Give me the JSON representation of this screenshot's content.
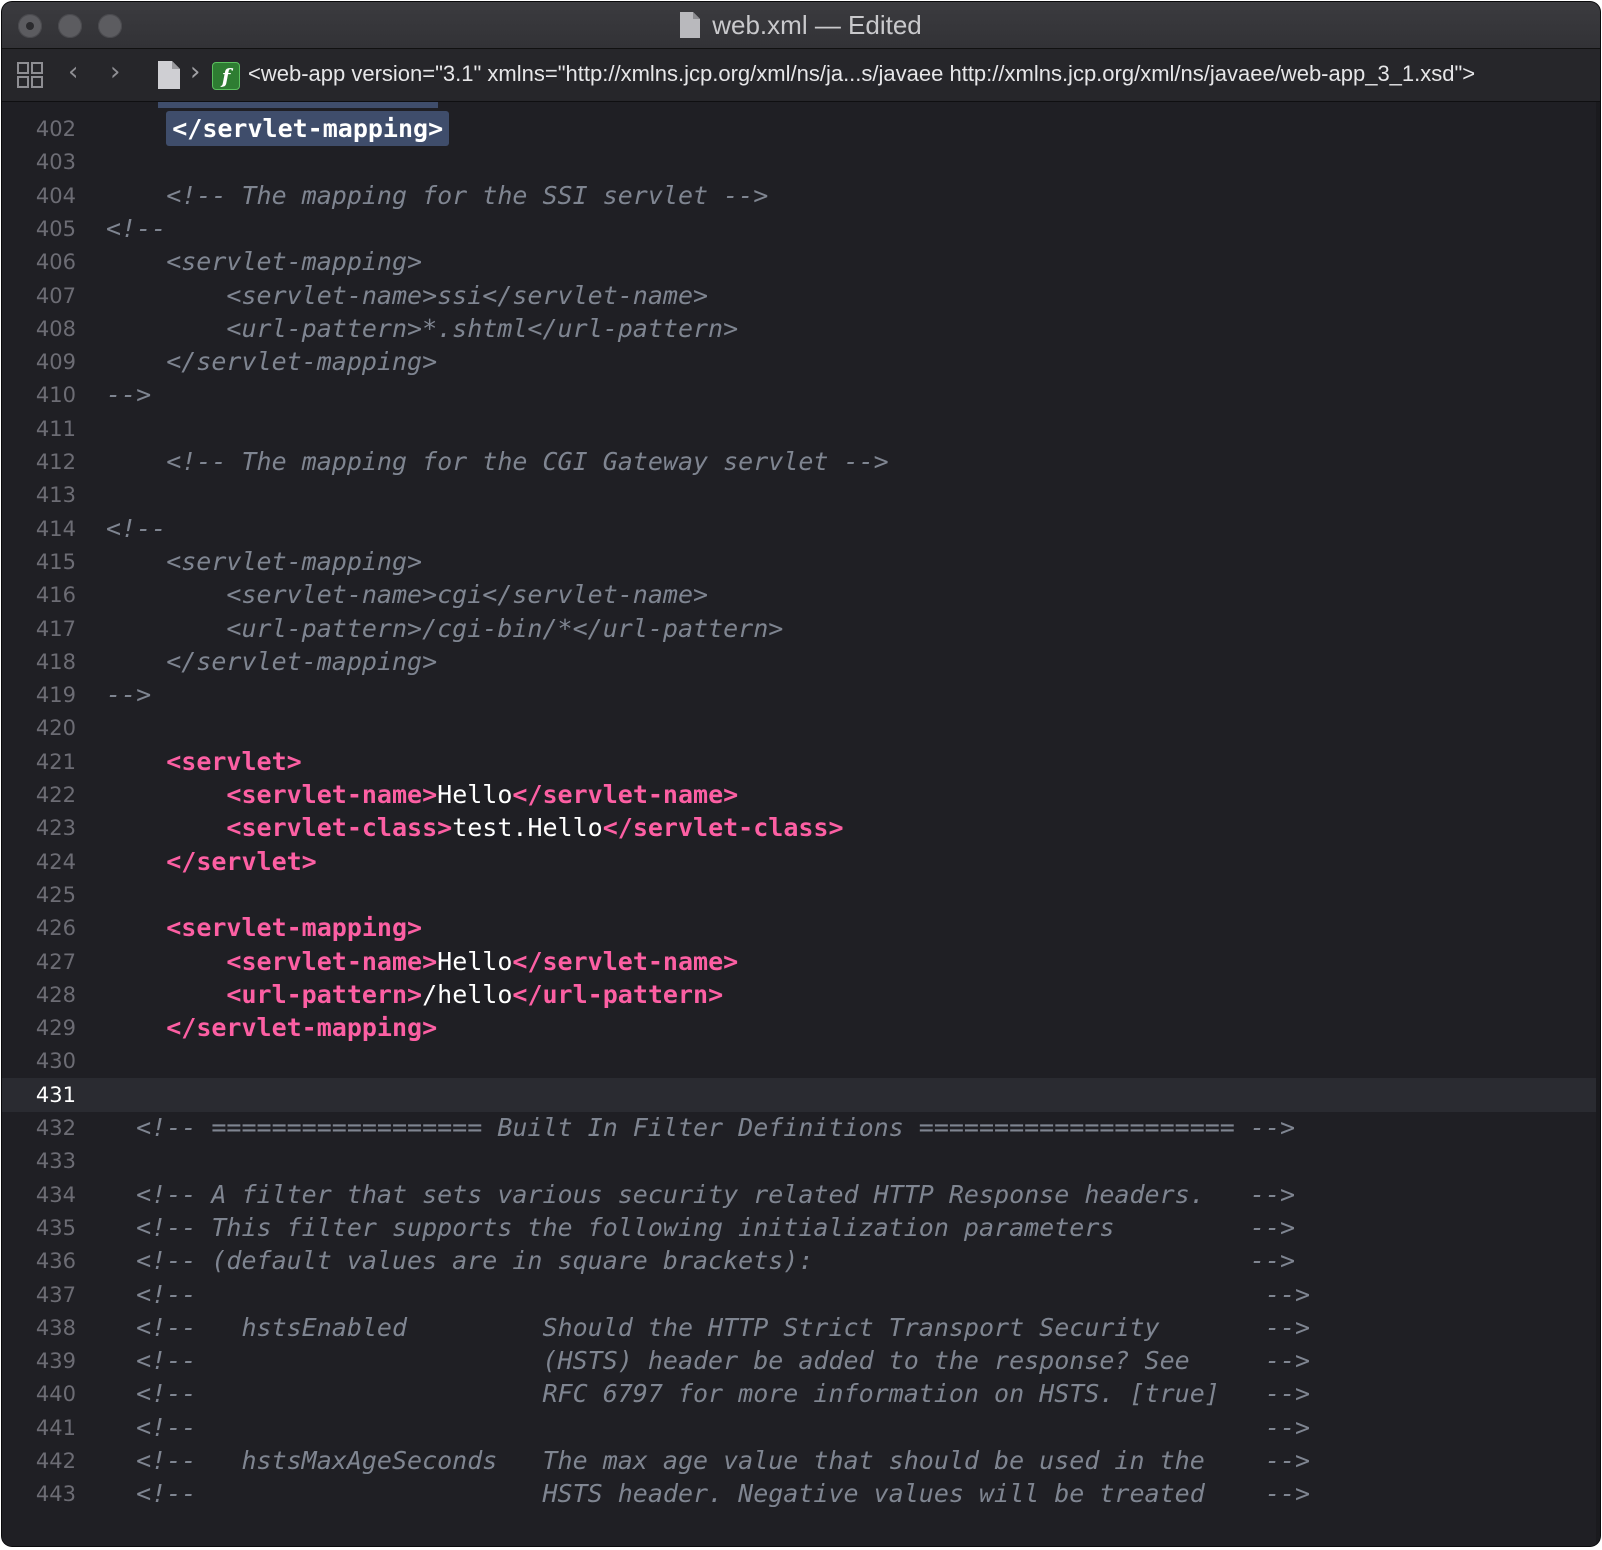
{
  "window": {
    "title": "web.xml — Edited"
  },
  "jumpbar": {
    "path": "<web-app version=\"3.1\" xmlns=\"http://xmlns.jcp.org/xml/ns/ja...s/javaee http://xmlns.jcp.org/xml/ns/javaee/web-app_3_1.xsd\">",
    "function_badge": "f"
  },
  "editor": {
    "current_line": "431",
    "lines": [
      {
        "n": "402",
        "tokens": [
          {
            "t": "    ",
            "c": ""
          },
          {
            "t": "</servlet-mapping>",
            "c": "sel"
          }
        ]
      },
      {
        "n": "403",
        "tokens": []
      },
      {
        "n": "404",
        "tokens": [
          {
            "t": "    <!-- The mapping for the SSI servlet -->",
            "c": "cm"
          }
        ]
      },
      {
        "n": "405",
        "tokens": [
          {
            "t": "<!--",
            "c": "cm"
          }
        ]
      },
      {
        "n": "406",
        "tokens": [
          {
            "t": "    <servlet-mapping>",
            "c": "cm"
          }
        ]
      },
      {
        "n": "407",
        "tokens": [
          {
            "t": "        <servlet-name>ssi</servlet-name>",
            "c": "cm"
          }
        ]
      },
      {
        "n": "408",
        "tokens": [
          {
            "t": "        <url-pattern>*.shtml</url-pattern>",
            "c": "cm"
          }
        ]
      },
      {
        "n": "409",
        "tokens": [
          {
            "t": "    </servlet-mapping>",
            "c": "cm"
          }
        ]
      },
      {
        "n": "410",
        "tokens": [
          {
            "t": "-->",
            "c": "cm"
          }
        ]
      },
      {
        "n": "411",
        "tokens": []
      },
      {
        "n": "412",
        "tokens": [
          {
            "t": "    <!-- The mapping for the CGI Gateway servlet -->",
            "c": "cm"
          }
        ]
      },
      {
        "n": "413",
        "tokens": []
      },
      {
        "n": "414",
        "tokens": [
          {
            "t": "<!--",
            "c": "cm"
          }
        ]
      },
      {
        "n": "415",
        "tokens": [
          {
            "t": "    <servlet-mapping>",
            "c": "cm"
          }
        ]
      },
      {
        "n": "416",
        "tokens": [
          {
            "t": "        <servlet-name>cgi</servlet-name>",
            "c": "cm"
          }
        ]
      },
      {
        "n": "417",
        "tokens": [
          {
            "t": "        <url-pattern>/cgi-bin/*</url-pattern>",
            "c": "cm"
          }
        ]
      },
      {
        "n": "418",
        "tokens": [
          {
            "t": "    </servlet-mapping>",
            "c": "cm"
          }
        ]
      },
      {
        "n": "419",
        "tokens": [
          {
            "t": "-->",
            "c": "cm"
          }
        ]
      },
      {
        "n": "420",
        "tokens": []
      },
      {
        "n": "421",
        "tokens": [
          {
            "t": "    ",
            "c": ""
          },
          {
            "t": "<servlet>",
            "c": "tag"
          }
        ]
      },
      {
        "n": "422",
        "tokens": [
          {
            "t": "        ",
            "c": ""
          },
          {
            "t": "<servlet-name>",
            "c": "tag"
          },
          {
            "t": "Hello",
            "c": "txt"
          },
          {
            "t": "</servlet-name>",
            "c": "tag"
          }
        ]
      },
      {
        "n": "423",
        "tokens": [
          {
            "t": "        ",
            "c": ""
          },
          {
            "t": "<servlet-class>",
            "c": "tag"
          },
          {
            "t": "test.Hello",
            "c": "txt"
          },
          {
            "t": "</servlet-class>",
            "c": "tag"
          }
        ]
      },
      {
        "n": "424",
        "tokens": [
          {
            "t": "    ",
            "c": ""
          },
          {
            "t": "</servlet>",
            "c": "tag"
          }
        ]
      },
      {
        "n": "425",
        "tokens": []
      },
      {
        "n": "426",
        "tokens": [
          {
            "t": "    ",
            "c": ""
          },
          {
            "t": "<servlet-mapping>",
            "c": "tag"
          }
        ]
      },
      {
        "n": "427",
        "tokens": [
          {
            "t": "        ",
            "c": ""
          },
          {
            "t": "<servlet-name>",
            "c": "tag"
          },
          {
            "t": "Hello",
            "c": "txt"
          },
          {
            "t": "</servlet-name>",
            "c": "tag"
          }
        ]
      },
      {
        "n": "428",
        "tokens": [
          {
            "t": "        ",
            "c": ""
          },
          {
            "t": "<url-pattern>",
            "c": "tag"
          },
          {
            "t": "/hello",
            "c": "txt"
          },
          {
            "t": "</url-pattern>",
            "c": "tag"
          }
        ]
      },
      {
        "n": "429",
        "tokens": [
          {
            "t": "    ",
            "c": ""
          },
          {
            "t": "</servlet-mapping>",
            "c": "tag"
          }
        ]
      },
      {
        "n": "430",
        "tokens": []
      },
      {
        "n": "431",
        "tokens": []
      },
      {
        "n": "432",
        "tokens": [
          {
            "t": "  <!-- ================== Built In Filter Definitions ===================== -->",
            "c": "cm"
          }
        ]
      },
      {
        "n": "433",
        "tokens": []
      },
      {
        "n": "434",
        "tokens": [
          {
            "t": "  <!-- A filter that sets various security related HTTP Response headers.   -->",
            "c": "cm"
          }
        ]
      },
      {
        "n": "435",
        "tokens": [
          {
            "t": "  <!-- This filter supports the following initialization parameters         -->",
            "c": "cm"
          }
        ]
      },
      {
        "n": "436",
        "tokens": [
          {
            "t": "  <!-- (default values are in square brackets):                             -->",
            "c": "cm"
          }
        ]
      },
      {
        "n": "437",
        "tokens": [
          {
            "t": "  <!--                                                                       -->",
            "c": "cm"
          }
        ]
      },
      {
        "n": "438",
        "tokens": [
          {
            "t": "  <!--   hstsEnabled         Should the HTTP Strict Transport Security       -->",
            "c": "cm"
          }
        ]
      },
      {
        "n": "439",
        "tokens": [
          {
            "t": "  <!--                       (HSTS) header be added to the response? See     -->",
            "c": "cm"
          }
        ]
      },
      {
        "n": "440",
        "tokens": [
          {
            "t": "  <!--                       RFC 6797 for more information on HSTS. [true]   -->",
            "c": "cm"
          }
        ]
      },
      {
        "n": "441",
        "tokens": [
          {
            "t": "  <!--                                                                       -->",
            "c": "cm"
          }
        ]
      },
      {
        "n": "442",
        "tokens": [
          {
            "t": "  <!--   hstsMaxAgeSeconds   The max age value that should be used in the    -->",
            "c": "cm"
          }
        ]
      },
      {
        "n": "443",
        "tokens": [
          {
            "t": "  <!--                       HSTS header. Negative values will be treated    -->",
            "c": "cm"
          }
        ]
      }
    ]
  },
  "colors": {
    "background": "#1f1f24",
    "tag": "#fc5fa3",
    "comment": "#7f8591",
    "text": "#ffffff",
    "selection": "#3f4d6b",
    "current_line": "#2a2b31"
  }
}
